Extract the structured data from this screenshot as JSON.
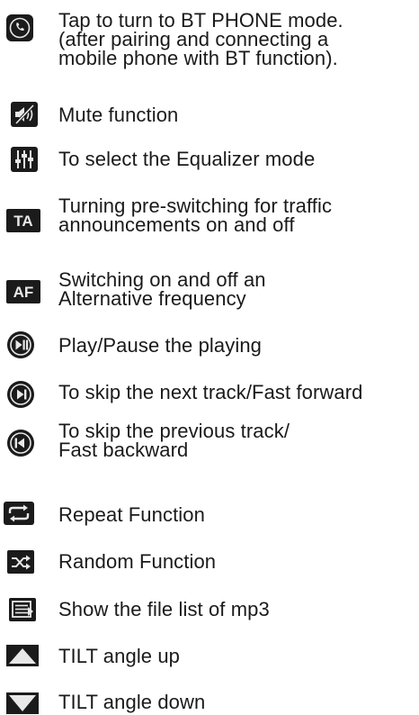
{
  "manual_list": {
    "items": [
      {
        "icon": "phone-icon",
        "lines": [
          "Tap to turn to BT PHONE mode.",
          "(after pairing and connecting a",
          "mobile phone with BT function)."
        ]
      },
      {
        "icon": "mute-icon",
        "lines": [
          "Mute function"
        ]
      },
      {
        "icon": "equalizer-icon",
        "lines": [
          "To select the Equalizer mode"
        ]
      },
      {
        "icon": "ta-icon",
        "icon_text": "TA",
        "lines": [
          "Turning pre-switching for traffic",
          "announcements on and off"
        ]
      },
      {
        "icon": "af-icon",
        "icon_text": "AF",
        "lines": [
          "Switching on and off an",
          "Alternative frequency"
        ]
      },
      {
        "icon": "play-pause-icon",
        "lines": [
          "Play/Pause the playing"
        ]
      },
      {
        "icon": "next-track-icon",
        "lines": [
          "To skip the next track/Fast forward"
        ]
      },
      {
        "icon": "previous-track-icon",
        "lines": [
          "To skip the previous track/",
          "Fast backward"
        ]
      },
      {
        "icon": "repeat-icon",
        "lines": [
          "Repeat Function"
        ]
      },
      {
        "icon": "random-icon",
        "lines": [
          "Random Function"
        ]
      },
      {
        "icon": "file-list-icon",
        "lines": [
          "Show the file list of mp3"
        ]
      },
      {
        "icon": "tilt-up-icon",
        "lines": [
          "TILT angle up"
        ]
      },
      {
        "icon": "tilt-down-icon",
        "lines": [
          "TILT angle down"
        ]
      }
    ]
  }
}
